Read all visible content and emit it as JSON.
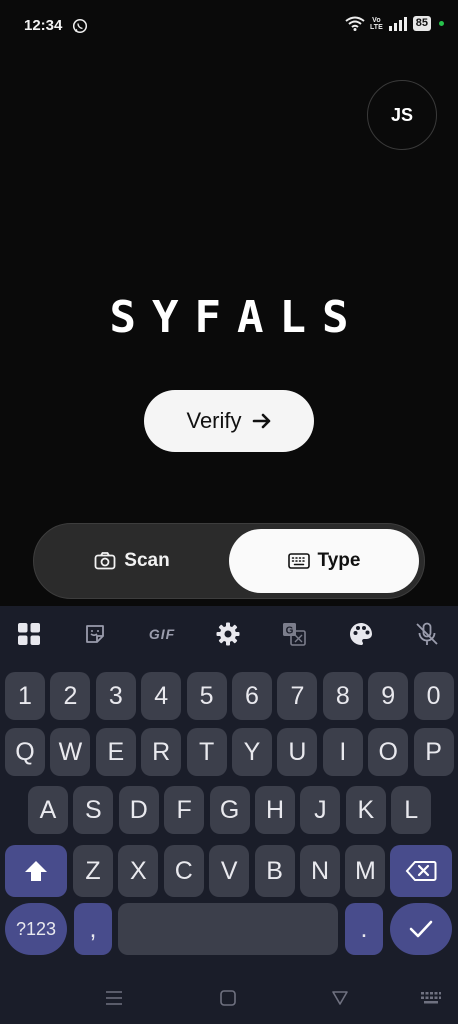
{
  "status_bar": {
    "time": "12:34",
    "volte": "Vo\nLTE",
    "battery": "85"
  },
  "avatar": {
    "initials": "JS"
  },
  "brand": {
    "title": "SYFALS"
  },
  "verify": {
    "label": "Verify"
  },
  "mode_toggle": {
    "scan_label": "Scan",
    "type_label": "Type",
    "selected": "Type"
  },
  "keyboard": {
    "number_row": [
      "1",
      "2",
      "3",
      "4",
      "5",
      "6",
      "7",
      "8",
      "9",
      "0"
    ],
    "row1": [
      "Q",
      "W",
      "E",
      "R",
      "T",
      "Y",
      "U",
      "I",
      "O",
      "P"
    ],
    "row2": [
      "A",
      "S",
      "D",
      "F",
      "G",
      "H",
      "J",
      "K",
      "L"
    ],
    "row3": [
      "Z",
      "X",
      "C",
      "V",
      "B",
      "N",
      "M"
    ],
    "symbols_label": "?123",
    "comma": ",",
    "period": ".",
    "toolbar_icons": [
      "apps-grid-icon",
      "sticker-icon",
      "gif-icon",
      "settings-gear-icon",
      "translate-icon",
      "palette-icon",
      "mic-off-icon"
    ],
    "gif_label": "GIF"
  },
  "colors": {
    "background": "#0a0a0a",
    "keyboard_bg": "#1a1d29",
    "key_bg": "#3c3f4b",
    "accent_key": "#484c8c",
    "battery_dot": "#27c24c"
  }
}
